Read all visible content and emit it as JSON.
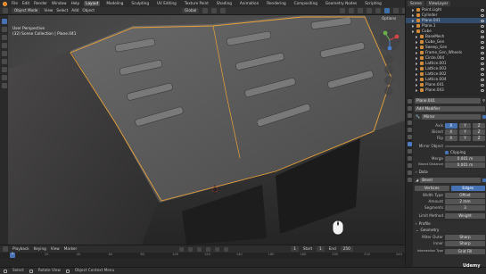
{
  "menu": {
    "items": [
      "File",
      "Edit",
      "Render",
      "Window",
      "Help"
    ],
    "workspaces": [
      "Layout",
      "Modeling",
      "Sculpting",
      "UV Editing",
      "Texture Paint",
      "Shading",
      "Animation",
      "Rendering",
      "Compositing",
      "Geometry Nodes",
      "Scripting"
    ],
    "active_workspace": "Layout",
    "scene": "Scene",
    "view_layer": "ViewLayer"
  },
  "viewport_header": {
    "mode": "Object Mode",
    "menus": [
      "View",
      "Select",
      "Add",
      "Object"
    ],
    "orientation": "Global",
    "options": "Options"
  },
  "viewport_info": {
    "view_name": "User Perspective",
    "collection_path": "(32) Scene Collection | Plane.041"
  },
  "outliner": {
    "rows": [
      {
        "label": "Point.Light",
        "selected": false
      },
      {
        "label": "Cylinder",
        "selected": false
      },
      {
        "label": "Plane.041",
        "selected": true
      },
      {
        "label": "Plane.1",
        "selected": false
      },
      {
        "label": "Cube",
        "selected": false
      },
      {
        "label": "BaseMesh",
        "selected": false
      },
      {
        "label": "Cube_Gen",
        "selected": false
      },
      {
        "label": "Sweep_Gen",
        "selected": false
      },
      {
        "label": "Frame_Gen_Wheels",
        "selected": false
      },
      {
        "label": "Circle.004",
        "selected": false
      },
      {
        "label": "Lattice.001",
        "selected": false
      },
      {
        "label": "Lattice.003",
        "selected": false
      },
      {
        "label": "Lattice.002",
        "selected": false
      },
      {
        "label": "Lattice.004",
        "selected": false
      },
      {
        "label": "Plane.041",
        "selected": false
      },
      {
        "label": "Plane.043",
        "selected": false
      }
    ]
  },
  "properties": {
    "object_name": "Plane.041",
    "add_modifier": "Add Modifier",
    "mirror": {
      "name": "Mirror",
      "axis_label": "Axis",
      "bisect_label": "Bisect",
      "flip_label": "Flip",
      "axes": [
        "X",
        "Y",
        "Z"
      ],
      "mirror_object_label": "Mirror Object",
      "clipping_label": "Clipping",
      "merge_label": "Merge",
      "merge_value": "0.001 m",
      "bisect_distance_label": "Bisect Distance",
      "bisect_distance_value": "0.001 m",
      "data_label": "Data"
    },
    "bevel": {
      "name": "Bevel",
      "tabs": [
        "Vertices",
        "Edges"
      ],
      "active_tab": "Edges",
      "width_type_label": "Width Type",
      "width_type_value": "Offset",
      "amount_label": "Amount",
      "amount_value": "2 mm",
      "segments_label": "Segments",
      "segments_value": "3",
      "limit_method_label": "Limit Method",
      "limit_method_value": "Weight",
      "profile_label": "Profile",
      "geometry_label": "Geometry",
      "miter_outer_label": "Miter Outer",
      "miter_outer_value": "Sharp",
      "inner_label": "Inner",
      "inner_value": "Sharp",
      "intersection_label": "Intersection Type",
      "intersection_value": "Grid Fill"
    }
  },
  "timeline": {
    "menus": [
      "Playback",
      "Keying",
      "View",
      "Marker"
    ],
    "current_frame": "1",
    "start_label": "Start",
    "start_value": "1",
    "end_label": "End",
    "end_value": "250",
    "ticks": [
      "0",
      "20",
      "40",
      "60",
      "80",
      "100",
      "120",
      "140",
      "160",
      "180",
      "200",
      "220",
      "240"
    ]
  },
  "statusbar": {
    "items": [
      "Select",
      "Rotate View",
      "Object Context Menu"
    ]
  },
  "watermark": "Udemy",
  "colors": {
    "accent_blue": "#4772b3",
    "selection_orange": "#e8a23a",
    "viewport_bg": "#4b4b4b"
  }
}
